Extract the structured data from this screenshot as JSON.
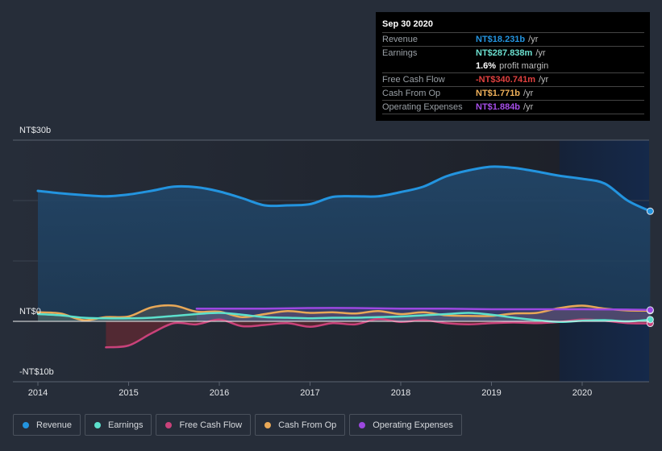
{
  "tooltip": {
    "date": "Sep 30 2020",
    "rows": [
      {
        "label": "Revenue",
        "value": "NT$18.231b",
        "unit": "/yr",
        "color": "#2394df"
      },
      {
        "label": "Earnings",
        "value": "NT$287.838m",
        "unit": "/yr",
        "color": "#6ce0d0"
      },
      {
        "label": "",
        "value": "1.6%",
        "unit": "profit margin",
        "color": "#ffffff"
      },
      {
        "label": "Free Cash Flow",
        "value": "-NT$340.741m",
        "unit": "/yr",
        "color": "#e0403f"
      },
      {
        "label": "Cash From Op",
        "value": "NT$1.771b",
        "unit": "/yr",
        "color": "#f0b15a"
      },
      {
        "label": "Operating Expenses",
        "value": "NT$1.884b",
        "unit": "/yr",
        "color": "#a64ee8"
      }
    ]
  },
  "legend": [
    {
      "label": "Revenue",
      "color": "#2394df"
    },
    {
      "label": "Earnings",
      "color": "#5ce0cc"
    },
    {
      "label": "Free Cash Flow",
      "color": "#c9427a"
    },
    {
      "label": "Cash From Op",
      "color": "#e8a857"
    },
    {
      "label": "Operating Expenses",
      "color": "#9c48e0"
    }
  ],
  "chart_data": {
    "type": "area",
    "title": "",
    "xlabel": "",
    "ylabel": "",
    "y_tick_labels": [
      "NT$30b",
      "NT$0",
      "-NT$10b"
    ],
    "ylim": [
      -10,
      30
    ],
    "y_unit": "NT$ billions",
    "x_tick_labels": [
      "2014",
      "2015",
      "2016",
      "2017",
      "2018",
      "2019",
      "2020"
    ],
    "xlim": [
      2013.72,
      2020.75
    ],
    "highlight_region_start": 2019.75,
    "grid": true,
    "legend_position": "bottom",
    "series": [
      {
        "name": "Revenue",
        "color": "#2394df",
        "x": [
          2014.0,
          2014.25,
          2014.5,
          2014.75,
          2015.0,
          2015.25,
          2015.5,
          2015.75,
          2016.0,
          2016.25,
          2016.5,
          2016.75,
          2017.0,
          2017.25,
          2017.5,
          2017.75,
          2018.0,
          2018.25,
          2018.5,
          2018.75,
          2019.0,
          2019.25,
          2019.5,
          2019.75,
          2020.0,
          2020.25,
          2020.5,
          2020.75
        ],
        "y": [
          21.6,
          21.2,
          20.9,
          20.7,
          21.0,
          21.6,
          22.3,
          22.2,
          21.5,
          20.4,
          19.2,
          19.2,
          19.4,
          20.6,
          20.7,
          20.7,
          21.4,
          22.3,
          24.0,
          25.0,
          25.6,
          25.4,
          24.8,
          24.1,
          23.6,
          22.8,
          20.0,
          18.231
        ]
      },
      {
        "name": "Earnings",
        "color": "#5ce0cc",
        "x": [
          2014.0,
          2014.25,
          2014.5,
          2014.75,
          2015.0,
          2015.25,
          2015.5,
          2015.75,
          2016.0,
          2016.25,
          2016.5,
          2016.75,
          2017.0,
          2017.25,
          2017.5,
          2017.75,
          2018.0,
          2018.25,
          2018.5,
          2018.75,
          2019.0,
          2019.25,
          2019.5,
          2019.75,
          2020.0,
          2020.25,
          2020.5,
          2020.75
        ],
        "y": [
          1.2,
          1.0,
          0.6,
          0.5,
          0.5,
          0.6,
          0.9,
          1.2,
          1.4,
          1.1,
          0.7,
          0.6,
          0.5,
          0.6,
          0.6,
          0.7,
          0.8,
          1.0,
          1.2,
          1.4,
          1.1,
          0.6,
          0.2,
          -0.1,
          0.1,
          0.2,
          0.0,
          0.288
        ]
      },
      {
        "name": "Free Cash Flow",
        "color": "#c9427a",
        "x": [
          2014.75,
          2015.0,
          2015.25,
          2015.5,
          2015.75,
          2016.0,
          2016.25,
          2016.5,
          2016.75,
          2017.0,
          2017.25,
          2017.5,
          2017.75,
          2018.0,
          2018.25,
          2018.5,
          2018.75,
          2019.0,
          2019.25,
          2019.5,
          2019.75,
          2020.0,
          2020.25,
          2020.5,
          2020.75
        ],
        "y": [
          -4.3,
          -4.0,
          -2.0,
          -0.3,
          -0.5,
          0.3,
          -0.8,
          -0.6,
          -0.3,
          -0.9,
          -0.3,
          -0.5,
          0.4,
          -0.1,
          0.2,
          -0.3,
          -0.5,
          -0.3,
          -0.2,
          -0.3,
          -0.1,
          0.3,
          0.1,
          -0.3,
          -0.341
        ]
      },
      {
        "name": "Cash From Op",
        "color": "#e8a857",
        "x": [
          2014.0,
          2014.25,
          2014.5,
          2014.75,
          2015.0,
          2015.25,
          2015.5,
          2015.75,
          2016.0,
          2016.25,
          2016.5,
          2016.75,
          2017.0,
          2017.25,
          2017.5,
          2017.75,
          2018.0,
          2018.25,
          2018.5,
          2018.75,
          2019.0,
          2019.25,
          2019.5,
          2019.75,
          2020.0,
          2020.25,
          2020.5,
          2020.75
        ],
        "y": [
          1.5,
          1.3,
          0.2,
          0.7,
          0.8,
          2.3,
          2.6,
          1.6,
          1.6,
          0.7,
          1.2,
          1.7,
          1.4,
          1.5,
          1.3,
          1.7,
          1.2,
          1.5,
          1.0,
          0.9,
          0.9,
          1.3,
          1.4,
          2.2,
          2.6,
          2.1,
          1.8,
          1.771
        ]
      },
      {
        "name": "Operating Expenses",
        "color": "#9c48e0",
        "x": [
          2015.75,
          2016.0,
          2016.5,
          2017.0,
          2017.5,
          2018.0,
          2018.5,
          2019.0,
          2019.5,
          2020.0,
          2020.5,
          2020.75
        ],
        "y": [
          2.1,
          2.1,
          2.1,
          2.2,
          2.2,
          2.1,
          2.1,
          2.0,
          2.0,
          2.0,
          1.95,
          1.884
        ]
      }
    ]
  }
}
